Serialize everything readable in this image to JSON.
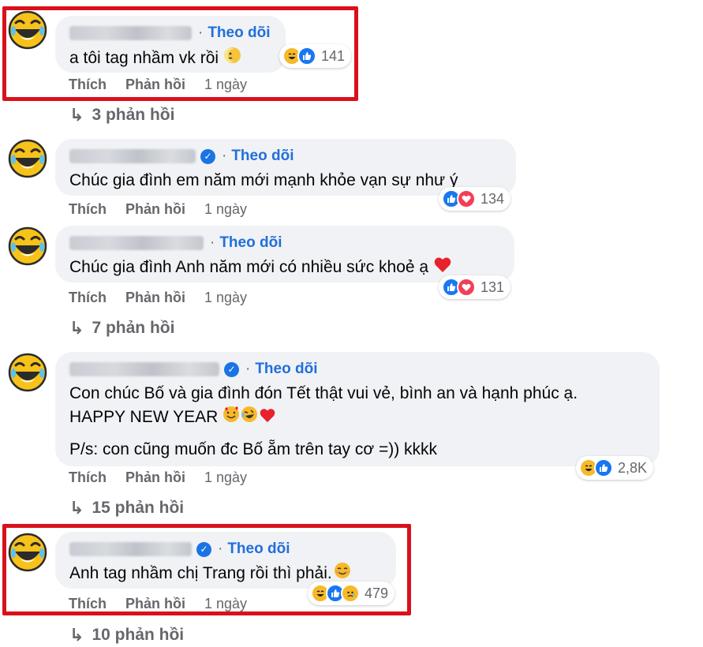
{
  "follow_label": "Theo dõi",
  "actions": {
    "like": "Thích",
    "reply": "Phản hồi"
  },
  "comments": [
    {
      "verified": false,
      "text": "a tôi tag nhầm vk rồi",
      "emoji": "crescent-moon-face",
      "reactions": [
        "haha",
        "like"
      ],
      "reaction_count": "141",
      "time": "1 ngày",
      "replies": "3 phản hồi",
      "highlighted": true
    },
    {
      "verified": true,
      "text": "Chúc gia đình em năm mới mạnh khỏe vạn sự như ý",
      "reactions": [
        "like",
        "love"
      ],
      "reaction_count": "134",
      "time": "1 ngày",
      "replies": null
    },
    {
      "verified": false,
      "text": "Chúc gia đình Anh năm mới có nhiều sức khoẻ ạ",
      "emoji": "red-heart",
      "reactions": [
        "like",
        "love"
      ],
      "reaction_count": "131",
      "time": "1 ngày",
      "replies": "7 phản hồi"
    },
    {
      "verified": true,
      "text": "Con chúc Bố và gia đình đón Tết thật vui vẻ, bình an và hạnh phúc ạ.",
      "text2": "HAPPY NEW YEAR",
      "emoji": "smiling-hearts laughing red-heart",
      "text3": "P/s: con cũng muốn đc Bố ẵm trên tay cơ =)) kkkk",
      "reactions": [
        "haha",
        "like"
      ],
      "reaction_count": "2,8K",
      "time": "1 ngày",
      "replies": "15 phản hồi"
    },
    {
      "verified": true,
      "text": "Anh tag nhầm chị Trang rồi thì phải.",
      "emoji": "smiling-face",
      "reactions": [
        "haha",
        "like",
        "sad"
      ],
      "reaction_count": "479",
      "time": "1 ngày",
      "replies": "10 phản hồi",
      "highlighted": true
    }
  ],
  "colors": {
    "bubble": "#f0f2f5",
    "link": "#216fdb",
    "meta": "#65676b",
    "highlight": "#d9111b",
    "like": "#1877f2",
    "love": "#f33e58",
    "haha": "#f7b928"
  },
  "icons": {
    "avatar": "laughing-tears-icon",
    "reply_arrow": "reply-arrow-icon"
  }
}
